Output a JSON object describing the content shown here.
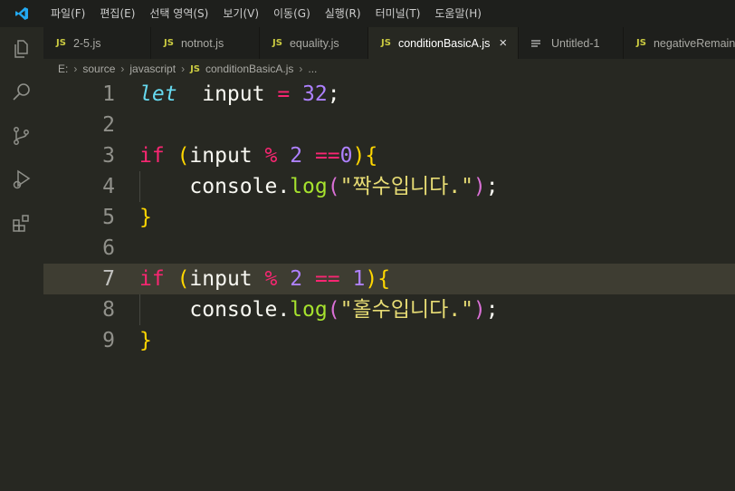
{
  "menu": [
    "파일(F)",
    "편집(E)",
    "선택 영역(S)",
    "보기(V)",
    "이동(G)",
    "실행(R)",
    "터미널(T)",
    "도움말(H)"
  ],
  "tabs": [
    {
      "label": "2-5.js",
      "type": "js"
    },
    {
      "label": "notnot.js",
      "type": "js"
    },
    {
      "label": "equality.js",
      "type": "js"
    },
    {
      "label": "conditionBasicA.js",
      "type": "js",
      "active": true,
      "close": "×"
    },
    {
      "label": "Untitled-1",
      "type": "text"
    },
    {
      "label": "negativeRemain",
      "type": "js"
    }
  ],
  "breadcrumb": {
    "parts": [
      "E:",
      "source",
      "javascript"
    ],
    "file": "conditionBasicA.js",
    "ellipsis": "...",
    "separator": "›",
    "js_badge": "JS"
  },
  "editor": {
    "current_line": 7,
    "lines": [
      {
        "n": "1",
        "tokens": [
          [
            "kw-let",
            "let"
          ],
          [
            "",
            "  input "
          ],
          [
            "op",
            "="
          ],
          [
            "",
            " "
          ],
          [
            "num",
            "32"
          ],
          [
            "",
            ";"
          ]
        ]
      },
      {
        "n": "2",
        "tokens": []
      },
      {
        "n": "3",
        "tokens": [
          [
            "kw",
            "if"
          ],
          [
            "",
            " "
          ],
          [
            "b1",
            "("
          ],
          [
            "",
            "input "
          ],
          [
            "op",
            "%"
          ],
          [
            "",
            " "
          ],
          [
            "num",
            "2"
          ],
          [
            "",
            " "
          ],
          [
            "op",
            "=="
          ],
          [
            "num",
            "0"
          ],
          [
            "b1",
            ")"
          ],
          [
            "b1",
            "{"
          ]
        ]
      },
      {
        "n": "4",
        "tokens": [
          [
            "",
            "    console."
          ],
          [
            "fn",
            "log"
          ],
          [
            "b2",
            "("
          ],
          [
            "str",
            "\"짝수입니다.\""
          ],
          [
            "b2",
            ")"
          ],
          [
            "",
            ";"
          ]
        ]
      },
      {
        "n": "5",
        "tokens": [
          [
            "b1",
            "}"
          ]
        ]
      },
      {
        "n": "6",
        "tokens": []
      },
      {
        "n": "7",
        "tokens": [
          [
            "kw",
            "if"
          ],
          [
            "",
            " "
          ],
          [
            "b1",
            "("
          ],
          [
            "",
            "input "
          ],
          [
            "op",
            "%"
          ],
          [
            "",
            " "
          ],
          [
            "num",
            "2"
          ],
          [
            "",
            " "
          ],
          [
            "op",
            "=="
          ],
          [
            "",
            " "
          ],
          [
            "num",
            "1"
          ],
          [
            "b1",
            ")"
          ],
          [
            "b1",
            "{"
          ]
        ]
      },
      {
        "n": "8",
        "tokens": [
          [
            "",
            "    console."
          ],
          [
            "fn",
            "log"
          ],
          [
            "b2",
            "("
          ],
          [
            "str",
            "\"홀수입니다.\""
          ],
          [
            "b2",
            ")"
          ],
          [
            "",
            ";"
          ]
        ]
      },
      {
        "n": "9",
        "tokens": [
          [
            "b1",
            "}"
          ]
        ]
      }
    ]
  },
  "icons": {
    "logo": "vscode-logo-icon",
    "activity": [
      "explorer-icon",
      "search-icon",
      "source-control-icon",
      "run-debug-icon",
      "extensions-icon"
    ]
  },
  "colors": {
    "accent": "#007acc",
    "keyword": "#f92672",
    "number": "#ae81ff",
    "function": "#a6e22e",
    "string": "#e6db74"
  }
}
